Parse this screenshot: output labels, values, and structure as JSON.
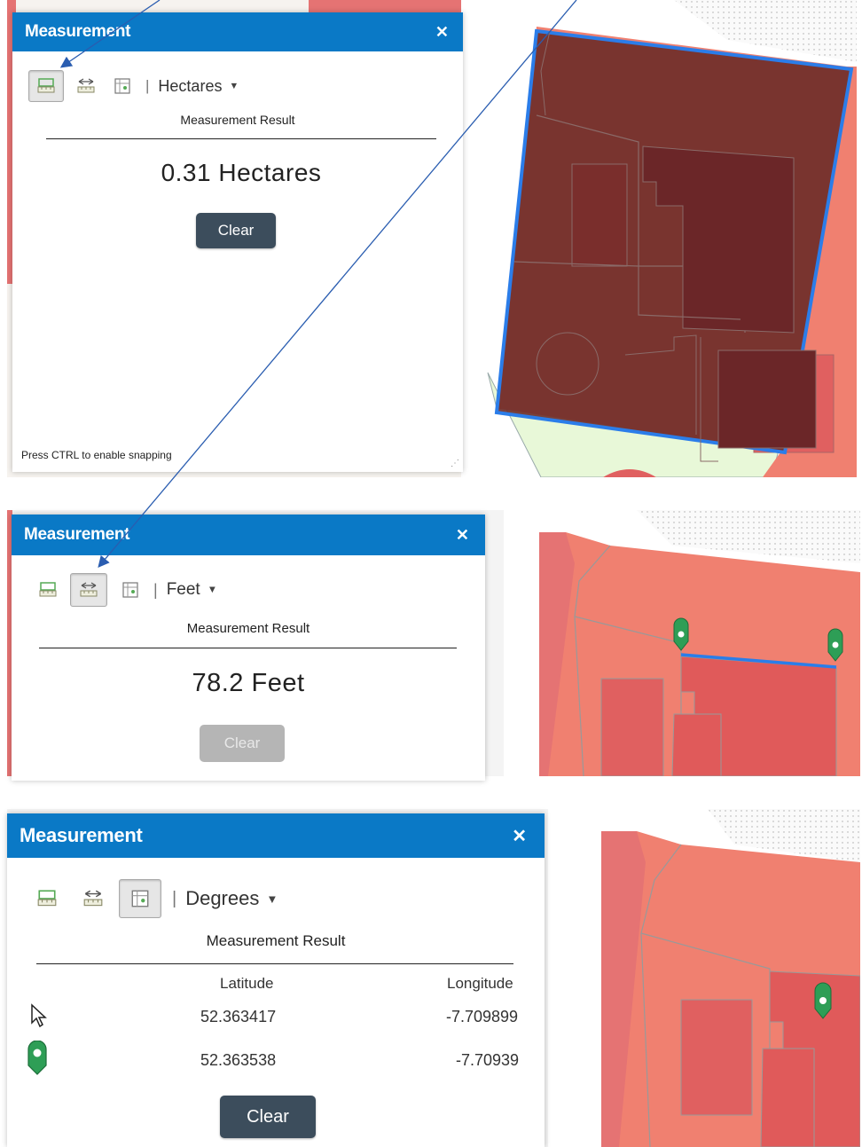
{
  "panels": [
    {
      "title": "Measurement",
      "close": "✕",
      "active_tool": "area",
      "unit": "Hectares",
      "result_label": "Measurement Result",
      "result_value": "0.31 Hectares",
      "clear_label": "Clear",
      "clear_enabled": true,
      "status_text": "Press CTRL to enable snapping"
    },
    {
      "title": "Measurement",
      "close": "✕",
      "active_tool": "distance",
      "unit": "Feet",
      "result_label": "Measurement Result",
      "result_value": "78.2 Feet",
      "clear_label": "Clear",
      "clear_enabled": false
    },
    {
      "title": "Measurement",
      "close": "✕",
      "active_tool": "location",
      "unit": "Degrees",
      "result_label": "Measurement Result",
      "columns": [
        "Latitude",
        "Longitude"
      ],
      "rows": [
        {
          "icon": "cursor-arrow-icon",
          "latitude": "52.363417",
          "longitude": "-7.709899"
        },
        {
          "icon": "map-pin-icon",
          "latitude": "52.363538",
          "longitude": "-7.70939"
        }
      ],
      "clear_label": "Clear",
      "clear_enabled": true
    }
  ],
  "colors": {
    "titlebar": "#0a79c6",
    "parcel": "#f08070",
    "parcel_dark": "#e05a5a",
    "measure_line": "#2b7de9",
    "pin": "#2e9e56",
    "green_area": "#e8f8d8"
  }
}
